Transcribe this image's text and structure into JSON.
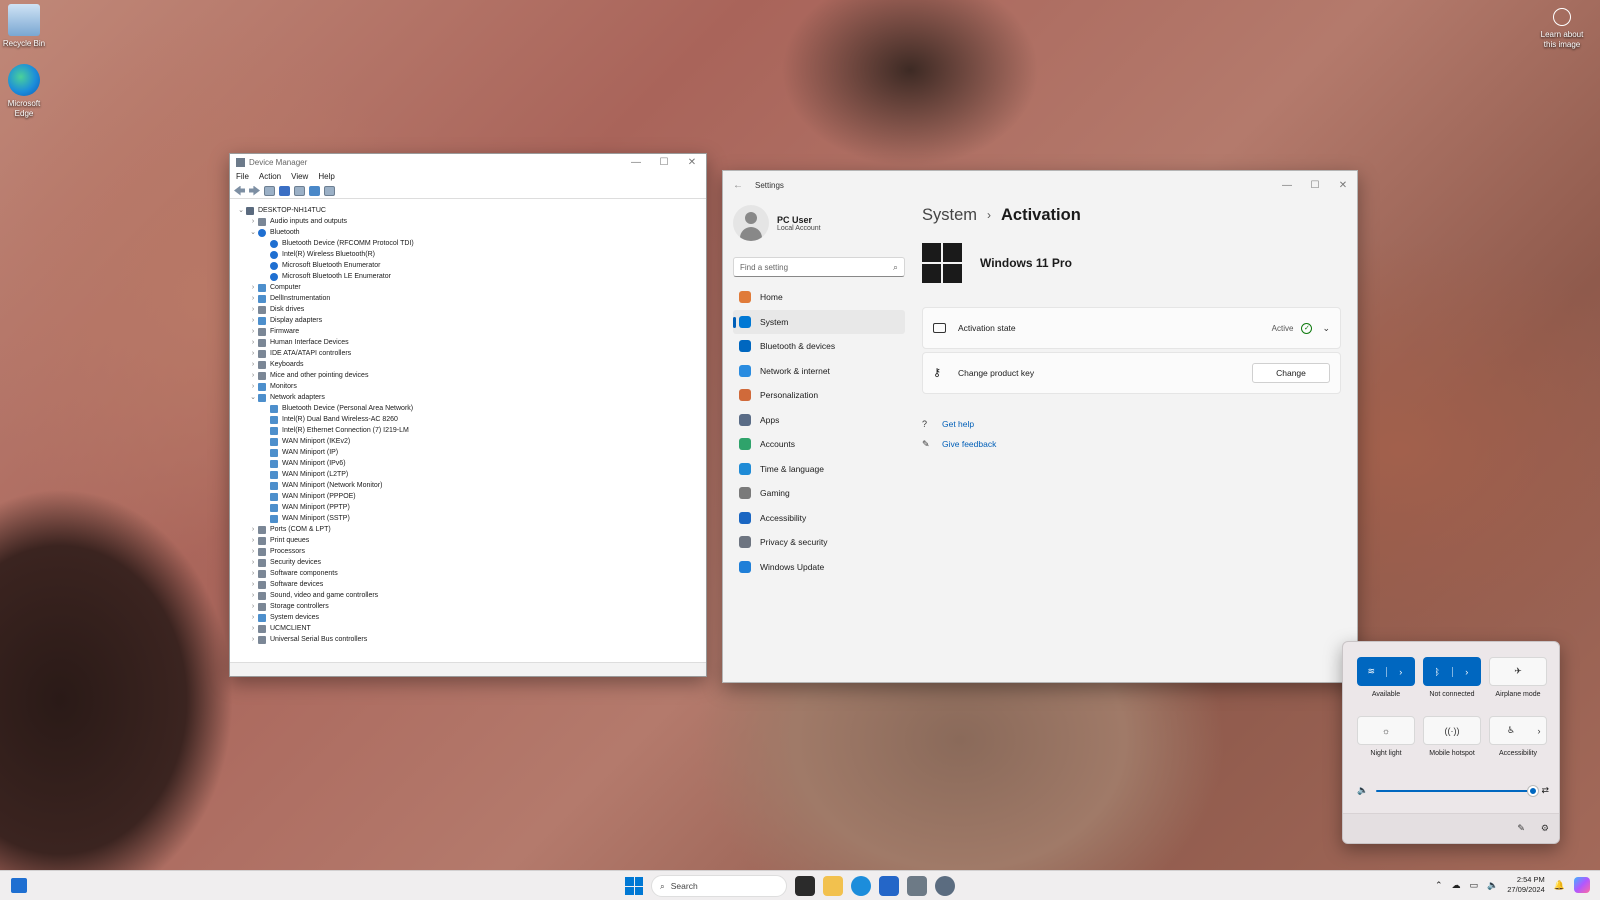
{
  "desktop": {
    "icons": [
      {
        "label": "Recycle Bin"
      },
      {
        "label": "Microsoft Edge"
      }
    ],
    "learn_label": "Learn about this image"
  },
  "device_manager": {
    "title": "Device Manager",
    "menu": [
      "File",
      "Action",
      "View",
      "Help"
    ],
    "tree": [
      {
        "text": "DESKTOP-NH14TUC",
        "level": 0,
        "expander": "⌄",
        "icon": "pc"
      },
      {
        "text": "Audio inputs and outputs",
        "level": 1,
        "expander": "›",
        "icon": "dev"
      },
      {
        "text": "Bluetooth",
        "level": 1,
        "expander": "⌄",
        "icon": "bt"
      },
      {
        "text": "Bluetooth Device (RFCOMM Protocol TDI)",
        "level": 2,
        "expander": "",
        "icon": "bt"
      },
      {
        "text": "Intel(R) Wireless Bluetooth(R)",
        "level": 2,
        "expander": "",
        "icon": "bt"
      },
      {
        "text": "Microsoft Bluetooth Enumerator",
        "level": 2,
        "expander": "",
        "icon": "bt"
      },
      {
        "text": "Microsoft Bluetooth LE Enumerator",
        "level": 2,
        "expander": "",
        "icon": "bt"
      },
      {
        "text": "Computer",
        "level": 1,
        "expander": "›",
        "icon": "net"
      },
      {
        "text": "DellInstrumentation",
        "level": 1,
        "expander": "›",
        "icon": "net"
      },
      {
        "text": "Disk drives",
        "level": 1,
        "expander": "›",
        "icon": "dev"
      },
      {
        "text": "Display adapters",
        "level": 1,
        "expander": "›",
        "icon": "net"
      },
      {
        "text": "Firmware",
        "level": 1,
        "expander": "›",
        "icon": "dev"
      },
      {
        "text": "Human Interface Devices",
        "level": 1,
        "expander": "›",
        "icon": "dev"
      },
      {
        "text": "IDE ATA/ATAPI controllers",
        "level": 1,
        "expander": "›",
        "icon": "dev"
      },
      {
        "text": "Keyboards",
        "level": 1,
        "expander": "›",
        "icon": "dev"
      },
      {
        "text": "Mice and other pointing devices",
        "level": 1,
        "expander": "›",
        "icon": "dev"
      },
      {
        "text": "Monitors",
        "level": 1,
        "expander": "›",
        "icon": "net"
      },
      {
        "text": "Network adapters",
        "level": 1,
        "expander": "⌄",
        "icon": "net"
      },
      {
        "text": "Bluetooth Device (Personal Area Network)",
        "level": 2,
        "expander": "",
        "icon": "net"
      },
      {
        "text": "Intel(R) Dual Band Wireless-AC 8260",
        "level": 2,
        "expander": "",
        "icon": "net"
      },
      {
        "text": "Intel(R) Ethernet Connection (7) I219-LM",
        "level": 2,
        "expander": "",
        "icon": "net"
      },
      {
        "text": "WAN Miniport (IKEv2)",
        "level": 2,
        "expander": "",
        "icon": "net"
      },
      {
        "text": "WAN Miniport (IP)",
        "level": 2,
        "expander": "",
        "icon": "net"
      },
      {
        "text": "WAN Miniport (IPv6)",
        "level": 2,
        "expander": "",
        "icon": "net"
      },
      {
        "text": "WAN Miniport (L2TP)",
        "level": 2,
        "expander": "",
        "icon": "net"
      },
      {
        "text": "WAN Miniport (Network Monitor)",
        "level": 2,
        "expander": "",
        "icon": "net"
      },
      {
        "text": "WAN Miniport (PPPOE)",
        "level": 2,
        "expander": "",
        "icon": "net"
      },
      {
        "text": "WAN Miniport (PPTP)",
        "level": 2,
        "expander": "",
        "icon": "net"
      },
      {
        "text": "WAN Miniport (SSTP)",
        "level": 2,
        "expander": "",
        "icon": "net"
      },
      {
        "text": "Ports (COM & LPT)",
        "level": 1,
        "expander": "›",
        "icon": "dev"
      },
      {
        "text": "Print queues",
        "level": 1,
        "expander": "›",
        "icon": "dev"
      },
      {
        "text": "Processors",
        "level": 1,
        "expander": "›",
        "icon": "dev"
      },
      {
        "text": "Security devices",
        "level": 1,
        "expander": "›",
        "icon": "dev"
      },
      {
        "text": "Software components",
        "level": 1,
        "expander": "›",
        "icon": "dev"
      },
      {
        "text": "Software devices",
        "level": 1,
        "expander": "›",
        "icon": "dev"
      },
      {
        "text": "Sound, video and game controllers",
        "level": 1,
        "expander": "›",
        "icon": "dev"
      },
      {
        "text": "Storage controllers",
        "level": 1,
        "expander": "›",
        "icon": "dev"
      },
      {
        "text": "System devices",
        "level": 1,
        "expander": "›",
        "icon": "net"
      },
      {
        "text": "UCMCLIENT",
        "level": 1,
        "expander": "›",
        "icon": "dev"
      },
      {
        "text": "Universal Serial Bus controllers",
        "level": 1,
        "expander": "›",
        "icon": "dev"
      }
    ]
  },
  "settings": {
    "title": "Settings",
    "user": {
      "name": "PC User",
      "account": "Local Account"
    },
    "search_placeholder": "Find a setting",
    "nav": [
      {
        "label": "Home",
        "icon": "home-icon",
        "color": "#e07b39",
        "active": false
      },
      {
        "label": "System",
        "icon": "system-icon",
        "color": "#0078d4",
        "active": true
      },
      {
        "label": "Bluetooth & devices",
        "icon": "bluetooth-icon",
        "color": "#0067c0",
        "active": false
      },
      {
        "label": "Network & internet",
        "icon": "wifi-icon",
        "color": "#2a8ce0",
        "active": false
      },
      {
        "label": "Personalization",
        "icon": "brush-icon",
        "color": "#d06a3a",
        "active": false
      },
      {
        "label": "Apps",
        "icon": "apps-icon",
        "color": "#5a6c86",
        "active": false
      },
      {
        "label": "Accounts",
        "icon": "person-icon",
        "color": "#2fa36b",
        "active": false
      },
      {
        "label": "Time & language",
        "icon": "globe-icon",
        "color": "#1f8bd6",
        "active": false
      },
      {
        "label": "Gaming",
        "icon": "controller-icon",
        "color": "#7a7a7a",
        "active": false
      },
      {
        "label": "Accessibility",
        "icon": "accessibility-icon",
        "color": "#1a66c2",
        "active": false
      },
      {
        "label": "Privacy & security",
        "icon": "shield-icon",
        "color": "#6d7480",
        "active": false
      },
      {
        "label": "Windows Update",
        "icon": "update-icon",
        "color": "#1f7fd8",
        "active": false
      }
    ],
    "breadcrumb": {
      "parent": "System",
      "current": "Activation"
    },
    "edition": "Windows 11 Pro",
    "activation_state": {
      "label": "Activation state",
      "value": "Active"
    },
    "product_key": {
      "label": "Change product key",
      "button": "Change"
    },
    "links": [
      {
        "label": "Get help"
      },
      {
        "label": "Give feedback"
      }
    ]
  },
  "quick_settings": {
    "tiles": [
      {
        "label": "Available",
        "on": true,
        "icon": "wifi-icon",
        "split": true
      },
      {
        "label": "Not connected",
        "on": true,
        "icon": "bluetooth-icon",
        "split": true
      },
      {
        "label": "Airplane mode",
        "on": false,
        "icon": "airplane-icon",
        "split": false
      },
      {
        "label": "Night light",
        "on": false,
        "icon": "sun-icon",
        "split": false
      },
      {
        "label": "Mobile hotspot",
        "on": false,
        "icon": "hotspot-icon",
        "split": false
      },
      {
        "label": "Accessibility",
        "on": false,
        "icon": "accessibility-icon",
        "split": true
      }
    ],
    "volume_level": 1.0
  },
  "taskbar": {
    "search_placeholder": "Search",
    "time": "2:54 PM",
    "date": "27/09/2024"
  }
}
